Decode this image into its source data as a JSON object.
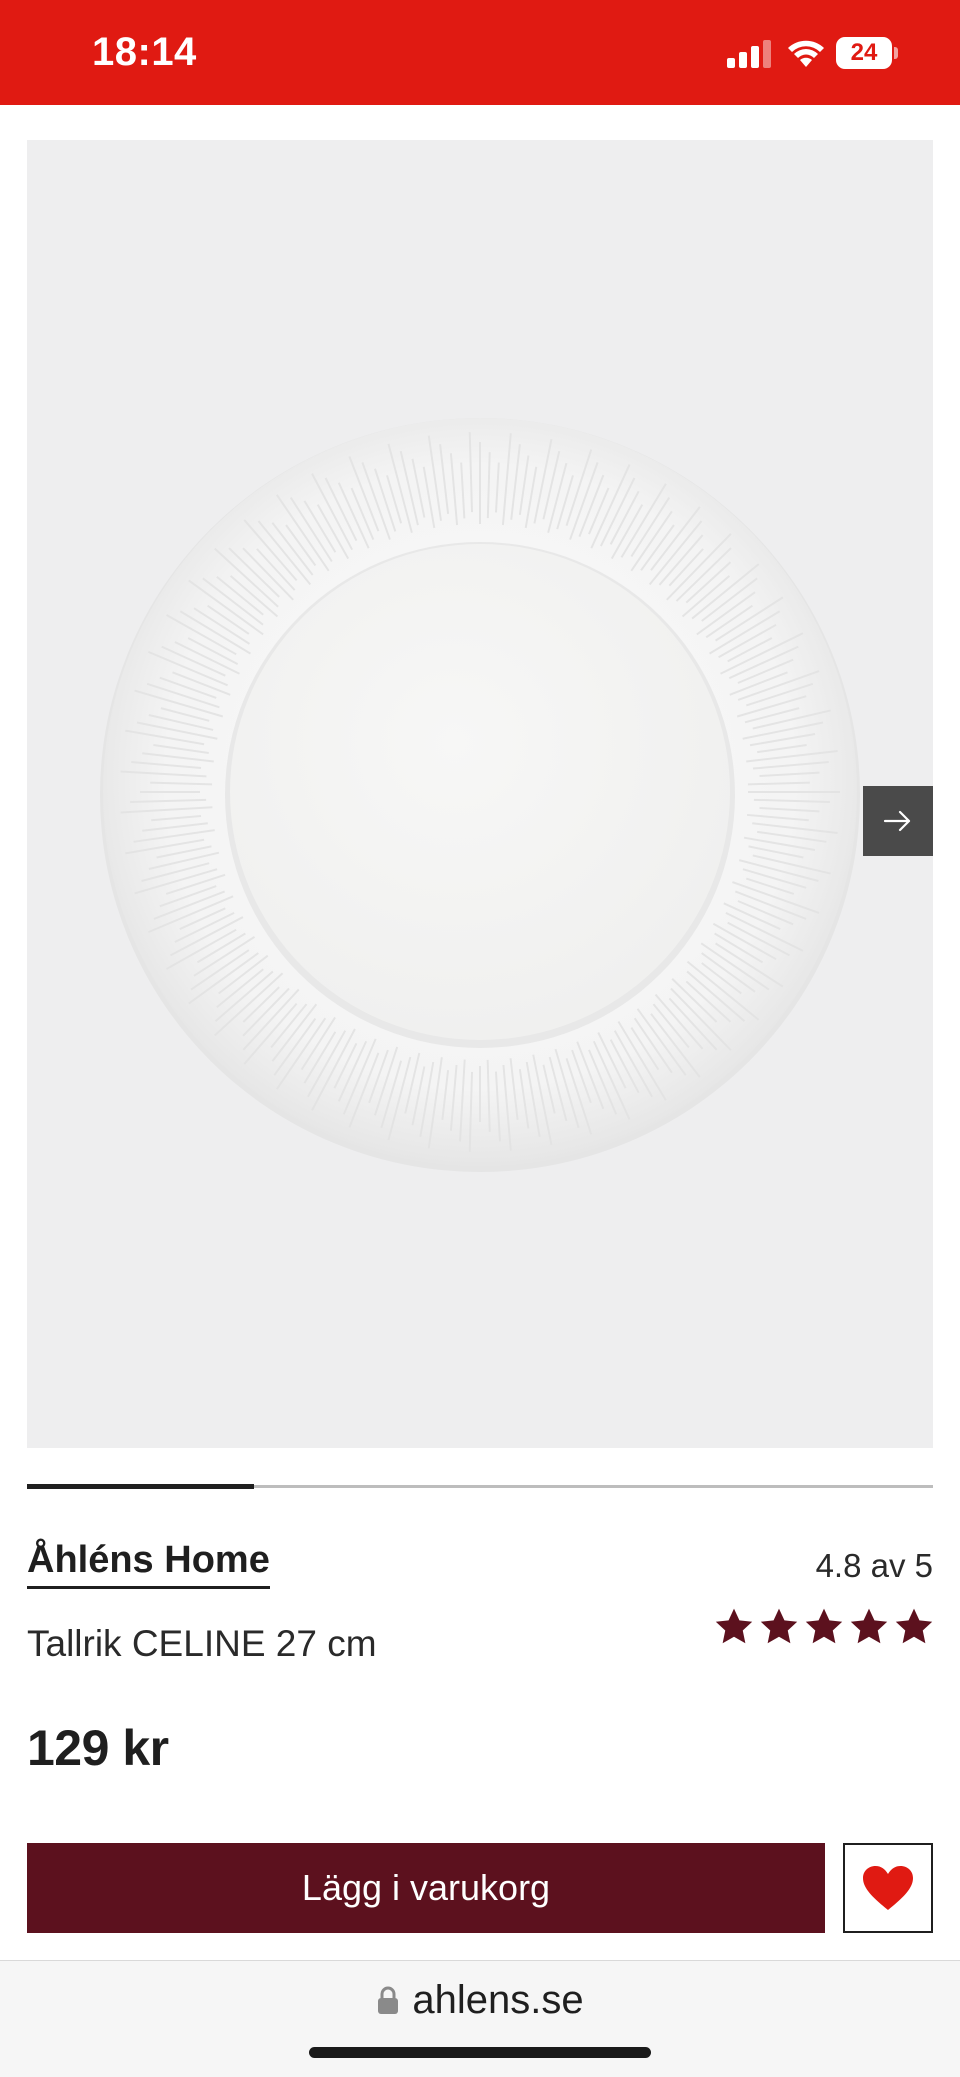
{
  "status_bar": {
    "time": "18:14",
    "battery_level": "24",
    "background_color": "#e01a12",
    "icons": [
      "signal-icon",
      "wifi-icon",
      "battery-icon"
    ]
  },
  "gallery": {
    "current_image": 1,
    "progress_fraction": 0.25,
    "next_icon": "arrow-right-icon"
  },
  "product": {
    "brand": "Åhléns Home",
    "name": "Tallrik CELINE 27 cm",
    "rating_text": "4.8 av 5",
    "rating_stars": 5,
    "price": "129 kr",
    "star_color": "#5c111e"
  },
  "actions": {
    "add_to_cart_label": "Lägg i varukorg",
    "button_color": "#5c111e",
    "wishlist_icon": "heart-icon",
    "heart_color": "#e01a12"
  },
  "browser": {
    "url": "ahlens.se",
    "lock_icon": "lock-icon"
  }
}
